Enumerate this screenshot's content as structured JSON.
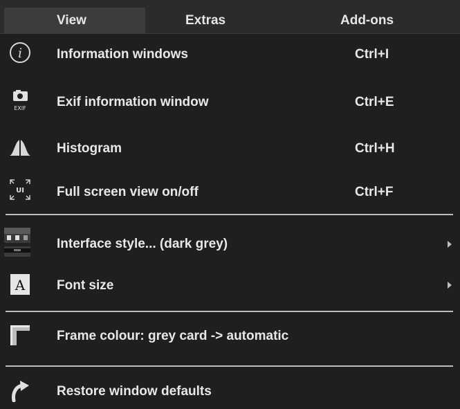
{
  "menubar": {
    "tabs": [
      {
        "label": "View"
      },
      {
        "label": "Extras"
      },
      {
        "label": "Add-ons"
      }
    ]
  },
  "menu": {
    "items": [
      {
        "label": "Information windows",
        "shortcut": "Ctrl+I",
        "icon": "info-icon"
      },
      {
        "label": "Exif information window",
        "shortcut": "Ctrl+E",
        "icon": "exif-camera-icon",
        "icon_text": "EXIF"
      },
      {
        "label": "Histogram",
        "shortcut": "Ctrl+H",
        "icon": "histogram-icon"
      },
      {
        "label": "Full screen view on/off",
        "shortcut": "Ctrl+F",
        "icon": "fullscreen-icon",
        "icon_text": "UI"
      },
      {
        "label": "Interface style... (dark grey)",
        "icon": "interface-style-icon",
        "submenu": true
      },
      {
        "label": "Font size",
        "icon": "font-size-icon",
        "icon_text": "A",
        "submenu": true
      },
      {
        "label": "Frame colour: grey card -> automatic",
        "icon": "frame-colour-icon"
      },
      {
        "label": "Restore window defaults",
        "icon": "restore-arrow-icon"
      }
    ]
  },
  "colors": {
    "background": "#1f1f1f",
    "menubar": "#2b2b2b",
    "active_tab": "#3c3c3c",
    "text": "#e8e8e8",
    "separator": "#bdbdbd"
  }
}
